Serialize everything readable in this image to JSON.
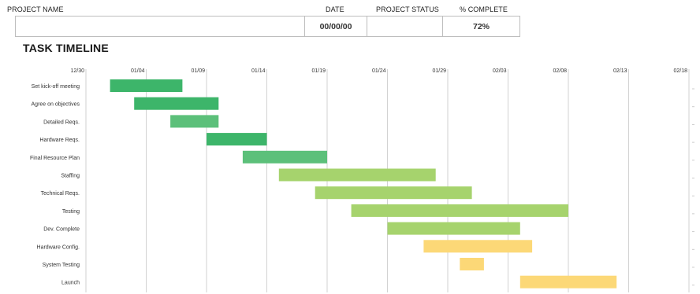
{
  "header": {
    "project_name_label": "PROJECT NAME",
    "date_label": "DATE",
    "status_label": "PROJECT STATUS",
    "complete_label": "% COMPLETE",
    "project_name_value": "",
    "date_value": "00/00/00",
    "status_value": "",
    "complete_value": "72%"
  },
  "section_title": "TASK TIMELINE",
  "chart_data": {
    "type": "gantt",
    "title": "TASK TIMELINE",
    "x_ticks": [
      "12/30",
      "01/04",
      "01/09",
      "01/14",
      "01/19",
      "01/24",
      "01/29",
      "02/03",
      "02/08",
      "02/13",
      "02/18"
    ],
    "x_range": [
      "12/30",
      "02/18"
    ],
    "grid": "vertical",
    "tasks": [
      {
        "name": "Set kick-off meeting",
        "start": "01/01",
        "end": "01/07",
        "color": "#3db56a"
      },
      {
        "name": "Agree on objectives",
        "start": "01/03",
        "end": "01/10",
        "color": "#3db56a"
      },
      {
        "name": "Detailed Reqs.",
        "start": "01/06",
        "end": "01/10",
        "color": "#5cc07a"
      },
      {
        "name": "Hardware Reqs.",
        "start": "01/09",
        "end": "01/14",
        "color": "#3db56a"
      },
      {
        "name": "Final Resource Plan",
        "start": "01/12",
        "end": "01/19",
        "color": "#5cc07a"
      },
      {
        "name": "Staffing",
        "start": "01/15",
        "end": "01/28",
        "color": "#a6d36d"
      },
      {
        "name": "Technical Reqs.",
        "start": "01/18",
        "end": "01/31",
        "color": "#a6d36d"
      },
      {
        "name": "Testing",
        "start": "01/21",
        "end": "02/08",
        "color": "#a6d36d"
      },
      {
        "name": "Dev. Complete",
        "start": "01/24",
        "end": "02/04",
        "color": "#a6d36d"
      },
      {
        "name": "Hardware Config.",
        "start": "01/27",
        "end": "02/05",
        "color": "#fcd877"
      },
      {
        "name": "System Testing",
        "start": "01/30",
        "end": "02/01",
        "color": "#fcd877"
      },
      {
        "name": "Launch",
        "start": "02/04",
        "end": "02/12",
        "color": "#fcd877"
      }
    ]
  }
}
